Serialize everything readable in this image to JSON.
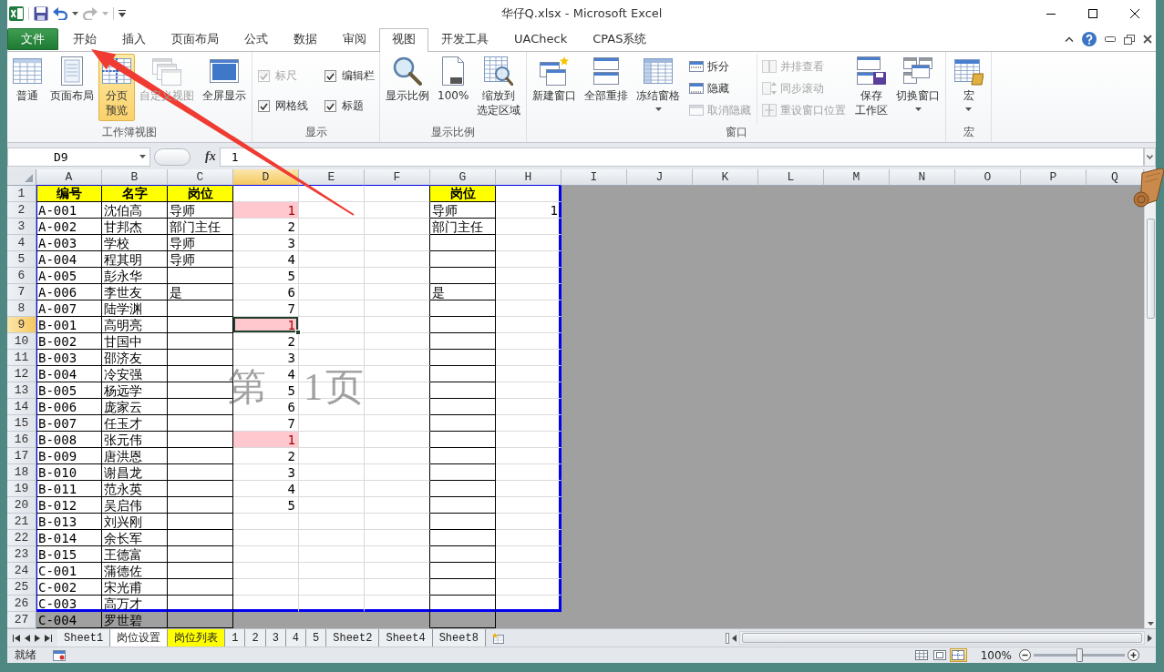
{
  "window": {
    "title": "华仔Q.xlsx - Microsoft Excel"
  },
  "ribbon_tabs": [
    {
      "label": "文件",
      "kind": "file",
      "selected": false
    },
    {
      "label": "开始",
      "kind": "tab",
      "selected": false
    },
    {
      "label": "插入",
      "kind": "tab",
      "selected": false
    },
    {
      "label": "页面布局",
      "kind": "tab",
      "selected": false
    },
    {
      "label": "公式",
      "kind": "tab",
      "selected": false
    },
    {
      "label": "数据",
      "kind": "tab",
      "selected": false
    },
    {
      "label": "审阅",
      "kind": "tab",
      "selected": false
    },
    {
      "label": "视图",
      "kind": "tab",
      "selected": true
    },
    {
      "label": "开发工具",
      "kind": "tab",
      "selected": false
    },
    {
      "label": "UACheck",
      "kind": "tab",
      "selected": false
    },
    {
      "label": "CPAS系统",
      "kind": "tab",
      "selected": false
    }
  ],
  "ribbon_groups": [
    {
      "label": "工作簿视图",
      "items": [
        {
          "kind": "large",
          "label": "普通",
          "selected": false,
          "disabled": false,
          "dropdown": false
        },
        {
          "kind": "large",
          "label": "页面布局",
          "selected": false,
          "disabled": false,
          "dropdown": false
        },
        {
          "kind": "large",
          "label": "分页预览",
          "selected": true,
          "disabled": false,
          "dropdown": false
        },
        {
          "kind": "large",
          "label": "自定义视图",
          "selected": false,
          "disabled": true,
          "dropdown": false
        },
        {
          "kind": "large",
          "label": "全屏显示",
          "selected": false,
          "disabled": false,
          "dropdown": false
        }
      ]
    },
    {
      "label": "显示",
      "items": [
        {
          "kind": "checks",
          "items": [
            {
              "label": "标尺",
              "checked": true,
              "disabled": true
            },
            {
              "label": "编辑栏",
              "checked": true,
              "disabled": false
            },
            {
              "label": "网格线",
              "checked": true,
              "disabled": false
            },
            {
              "label": "标题",
              "checked": true,
              "disabled": false
            }
          ]
        }
      ]
    },
    {
      "label": "显示比例",
      "items": [
        {
          "kind": "large",
          "label": "显示比例",
          "disabled": false,
          "dropdown": false
        },
        {
          "kind": "large",
          "label": "100%",
          "disabled": false,
          "dropdown": false
        },
        {
          "kind": "large",
          "label": "缩放到选定区域",
          "disabled": false,
          "dropdown": false
        }
      ]
    },
    {
      "label": "窗口",
      "items": [
        {
          "kind": "large",
          "label": "新建窗口",
          "disabled": false,
          "dropdown": false
        },
        {
          "kind": "large",
          "label": "全部重排",
          "disabled": false,
          "dropdown": false
        },
        {
          "kind": "large",
          "label": "冻结窗格",
          "disabled": false,
          "dropdown": true
        },
        {
          "kind": "stack",
          "items": [
            {
              "label": "拆分",
              "disabled": false
            },
            {
              "label": "隐藏",
              "disabled": false
            },
            {
              "label": "取消隐藏",
              "disabled": true
            }
          ]
        },
        {
          "kind": "stack",
          "items": [
            {
              "label": "并排查看",
              "disabled": true
            },
            {
              "label": "同步滚动",
              "disabled": true
            },
            {
              "label": "重设窗口位置",
              "disabled": true
            }
          ]
        },
        {
          "kind": "large",
          "label": "保存工作区",
          "disabled": false,
          "dropdown": false
        },
        {
          "kind": "large",
          "label": "切换窗口",
          "disabled": false,
          "dropdown": true
        }
      ]
    },
    {
      "label": "宏",
      "items": [
        {
          "kind": "large",
          "label": "宏",
          "disabled": false,
          "dropdown": true
        }
      ]
    }
  ],
  "formula_bar": {
    "name_box": "D9",
    "function_button": "fx",
    "value": "1"
  },
  "sheet": {
    "page_label": {
      "prefix": "第",
      "number": "1",
      "suffix": "页"
    },
    "columns": [
      {
        "label": "A",
        "selected": false,
        "bordered": true
      },
      {
        "label": "B",
        "selected": false,
        "bordered": true
      },
      {
        "label": "C",
        "selected": false,
        "bordered": true
      },
      {
        "label": "D",
        "selected": true,
        "bordered": false
      },
      {
        "label": "E",
        "selected": false,
        "bordered": false
      },
      {
        "label": "F",
        "selected": false,
        "bordered": false
      },
      {
        "label": "G",
        "selected": false,
        "bordered": true
      },
      {
        "label": "H",
        "selected": false,
        "bordered": false
      }
    ],
    "columns_outside_print_area": [
      {
        "label": "I",
        "selected": false
      },
      {
        "label": "J",
        "selected": false
      },
      {
        "label": "K",
        "selected": false
      },
      {
        "label": "L",
        "selected": false
      },
      {
        "label": "M",
        "selected": false
      },
      {
        "label": "N",
        "selected": false
      },
      {
        "label": "O",
        "selected": false
      },
      {
        "label": "P",
        "selected": false
      },
      {
        "label": "Q",
        "selected": false
      }
    ],
    "rows": [
      {
        "label": "1",
        "selected": false,
        "in_print_area": true,
        "kind": "header",
        "cells": {
          "A": "编号",
          "B": "名字",
          "C": "岗位",
          "G": "岗位"
        }
      },
      {
        "label": "2",
        "selected": false,
        "in_print_area": true,
        "kind": "data",
        "cells": {
          "A": "A-001",
          "B": "沈伯高",
          "C": "导师",
          "D": {
            "number": "1",
            "highlighted": true
          },
          "G": "导师",
          "H": {
            "number": "1",
            "highlighted": false
          }
        }
      },
      {
        "label": "3",
        "selected": false,
        "in_print_area": true,
        "kind": "data",
        "cells": {
          "A": "A-002",
          "B": "甘邦杰",
          "C": "部门主任",
          "D": {
            "number": "2",
            "highlighted": false
          },
          "G": "部门主任"
        }
      },
      {
        "label": "4",
        "selected": false,
        "in_print_area": true,
        "kind": "data",
        "cells": {
          "A": "A-003",
          "B": "学校",
          "C": "导师",
          "D": {
            "number": "3",
            "highlighted": false
          }
        }
      },
      {
        "label": "5",
        "selected": false,
        "in_print_area": true,
        "kind": "data",
        "cells": {
          "A": "A-004",
          "B": "程其明",
          "C": "导师",
          "D": {
            "number": "4",
            "highlighted": false
          }
        }
      },
      {
        "label": "6",
        "selected": false,
        "in_print_area": true,
        "kind": "data",
        "cells": {
          "A": "A-005",
          "B": "彭永华",
          "D": {
            "number": "5",
            "highlighted": false
          }
        }
      },
      {
        "label": "7",
        "selected": false,
        "in_print_area": true,
        "kind": "data",
        "cells": {
          "A": "A-006",
          "B": "李世友",
          "C": "是",
          "D": {
            "number": "6",
            "highlighted": false
          },
          "G": "是"
        }
      },
      {
        "label": "8",
        "selected": false,
        "in_print_area": true,
        "kind": "data",
        "cells": {
          "A": "A-007",
          "B": "陆学渊",
          "D": {
            "number": "7",
            "highlighted": false
          }
        }
      },
      {
        "label": "9",
        "selected": true,
        "in_print_area": true,
        "kind": "data",
        "cells": {
          "A": "B-001",
          "B": "高明亮",
          "D": {
            "number": "1",
            "highlighted": true
          }
        }
      },
      {
        "label": "10",
        "selected": false,
        "in_print_area": true,
        "kind": "data",
        "cells": {
          "A": "B-002",
          "B": "甘国中",
          "D": {
            "number": "2",
            "highlighted": false
          }
        }
      },
      {
        "label": "11",
        "selected": false,
        "in_print_area": true,
        "kind": "data",
        "cells": {
          "A": "B-003",
          "B": "邵济友",
          "D": {
            "number": "3",
            "highlighted": false
          }
        }
      },
      {
        "label": "12",
        "selected": false,
        "in_print_area": true,
        "kind": "data",
        "cells": {
          "A": "B-004",
          "B": "冷安强",
          "D": {
            "number": "4",
            "highlighted": false
          }
        }
      },
      {
        "label": "13",
        "selected": false,
        "in_print_area": true,
        "kind": "data",
        "cells": {
          "A": "B-005",
          "B": "杨远学",
          "D": {
            "number": "5",
            "highlighted": false
          }
        }
      },
      {
        "label": "14",
        "selected": false,
        "in_print_area": true,
        "kind": "data",
        "cells": {
          "A": "B-006",
          "B": "庞家云",
          "D": {
            "number": "6",
            "highlighted": false
          }
        }
      },
      {
        "label": "15",
        "selected": false,
        "in_print_area": true,
        "kind": "data",
        "cells": {
          "A": "B-007",
          "B": "任玉才",
          "D": {
            "number": "7",
            "highlighted": false
          }
        }
      },
      {
        "label": "16",
        "selected": false,
        "in_print_area": true,
        "kind": "data",
        "cells": {
          "A": "B-008",
          "B": "张元伟",
          "D": {
            "number": "1",
            "highlighted": true
          }
        }
      },
      {
        "label": "17",
        "selected": false,
        "in_print_area": true,
        "kind": "data",
        "cells": {
          "A": "B-009",
          "B": "唐洪恩",
          "D": {
            "number": "2",
            "highlighted": false
          }
        }
      },
      {
        "label": "18",
        "selected": false,
        "in_print_area": true,
        "kind": "data",
        "cells": {
          "A": "B-010",
          "B": "谢昌龙",
          "D": {
            "number": "3",
            "highlighted": false
          }
        }
      },
      {
        "label": "19",
        "selected": false,
        "in_print_area": true,
        "kind": "data",
        "cells": {
          "A": "B-011",
          "B": "范永英",
          "D": {
            "number": "4",
            "highlighted": false
          }
        }
      },
      {
        "label": "20",
        "selected": false,
        "in_print_area": true,
        "kind": "data",
        "cells": {
          "A": "B-012",
          "B": "吴启伟",
          "D": {
            "number": "5",
            "highlighted": false
          }
        }
      },
      {
        "label": "21",
        "selected": false,
        "in_print_area": true,
        "kind": "data",
        "cells": {
          "A": "B-013",
          "B": "刘兴刚"
        }
      },
      {
        "label": "22",
        "selected": false,
        "in_print_area": true,
        "kind": "data",
        "cells": {
          "A": "B-014",
          "B": "余长军"
        }
      },
      {
        "label": "23",
        "selected": false,
        "in_print_area": true,
        "kind": "data",
        "cells": {
          "A": "B-015",
          "B": "王德富"
        }
      },
      {
        "label": "24",
        "selected": false,
        "in_print_area": true,
        "kind": "data",
        "cells": {
          "A": "C-001",
          "B": "蒲德佐"
        }
      },
      {
        "label": "25",
        "selected": false,
        "in_print_area": true,
        "kind": "data",
        "cells": {
          "A": "C-002",
          "B": "宋光甫"
        }
      },
      {
        "label": "26",
        "selected": false,
        "in_print_area": true,
        "kind": "data",
        "cells": {
          "A": "C-003",
          "B": "高万才"
        }
      },
      {
        "label": "27",
        "selected": false,
        "in_print_area": false,
        "kind": "data",
        "cells": {
          "A": "C-004",
          "B": "罗世碧"
        }
      }
    ]
  },
  "sheet_tabs": [
    {
      "label": "Sheet1",
      "selected": false
    },
    {
      "label": "岗位设置",
      "selected": true
    },
    {
      "label": "岗位列表",
      "selected": false,
      "color": "#ffff00"
    },
    {
      "label": "1",
      "selected": false
    },
    {
      "label": "2",
      "selected": false
    },
    {
      "label": "3",
      "selected": false
    },
    {
      "label": "4",
      "selected": false
    },
    {
      "label": "5",
      "selected": false
    },
    {
      "label": "Sheet2",
      "selected": false
    },
    {
      "label": "Sheet4",
      "selected": false
    },
    {
      "label": "Sheet8",
      "selected": false
    }
  ],
  "status_bar": {
    "status": "就绪",
    "views": [
      {
        "selected": false
      },
      {
        "selected": false
      },
      {
        "selected": true
      }
    ],
    "zoom": "100%",
    "zoom_slider": {
      "level": 0.5
    }
  },
  "annotations": [
    {
      "kind": "arrow"
    }
  ]
}
